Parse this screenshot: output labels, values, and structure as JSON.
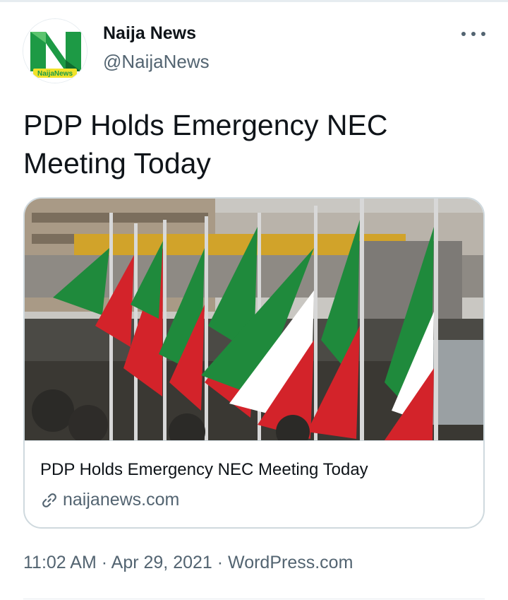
{
  "author": {
    "display_name": "Naija News",
    "handle": "@NaijaNews",
    "avatar_icon": "naija-news-logo",
    "avatar_logo_text": "NaijaNews"
  },
  "tweet": {
    "text": "PDP Holds Emergency NEC Meeting Today",
    "time": "11:02 AM",
    "separator": "·",
    "date": "Apr 29, 2021",
    "source": "WordPress.com"
  },
  "card": {
    "title": "PDP Holds Emergency NEC Meeting Today",
    "domain": "naijanews.com",
    "link_icon": "link-icon",
    "image_description_icon": "pdp-flags-photo"
  },
  "colors": {
    "text_primary": "#0f1419",
    "text_secondary": "#536471",
    "border": "#cfd9de",
    "flag_green": "#1f8a3c",
    "flag_red": "#d3232a",
    "logo_green": "#1d9a45"
  }
}
